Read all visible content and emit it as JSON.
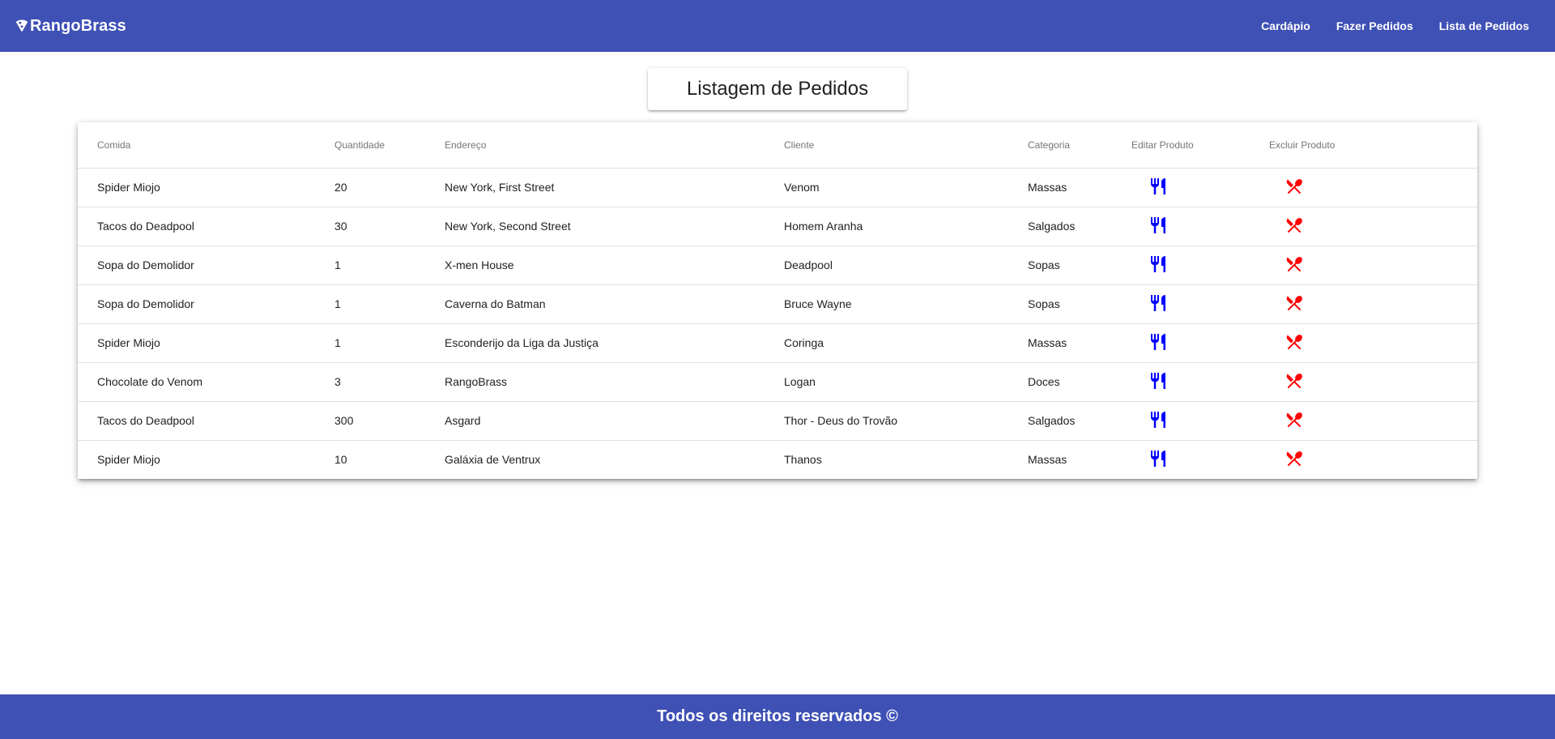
{
  "brand": {
    "name": "RangoBrass",
    "icon": "pizza-icon"
  },
  "nav": {
    "links": [
      {
        "label": "Cardápio"
      },
      {
        "label": "Fazer Pedidos"
      },
      {
        "label": "Lista de Pedidos"
      }
    ]
  },
  "page": {
    "title": "Listagem de Pedidos"
  },
  "table": {
    "headers": [
      "Comida",
      "Quantidade",
      "Endereço",
      "Cliente",
      "Categoria",
      "Editar Produto",
      "Excluir Produto"
    ],
    "rows": [
      {
        "comida": "Spider Miojo",
        "quantidade": "20",
        "endereco": "New York, First Street",
        "cliente": "Venom",
        "categoria": "Massas"
      },
      {
        "comida": "Tacos do Deadpool",
        "quantidade": "30",
        "endereco": "New York, Second Street",
        "cliente": "Homem Aranha",
        "categoria": "Salgados"
      },
      {
        "comida": "Sopa do Demolidor",
        "quantidade": "1",
        "endereco": "X-men House",
        "cliente": "Deadpool",
        "categoria": "Sopas"
      },
      {
        "comida": "Sopa do Demolidor",
        "quantidade": "1",
        "endereco": "Caverna do Batman",
        "cliente": "Bruce Wayne",
        "categoria": "Sopas"
      },
      {
        "comida": "Spider Miojo",
        "quantidade": "1",
        "endereco": "Esconderijo da Liga da Justiça",
        "cliente": "Coringa",
        "categoria": "Massas"
      },
      {
        "comida": "Chocolate do Venom",
        "quantidade": "3",
        "endereco": "RangoBrass",
        "cliente": "Logan",
        "categoria": "Doces"
      },
      {
        "comida": "Tacos do Deadpool",
        "quantidade": "300",
        "endereco": "Asgard",
        "cliente": "Thor - Deus do Trovão",
        "categoria": "Salgados"
      },
      {
        "comida": "Spider Miojo",
        "quantidade": "10",
        "endereco": "Galáxia de Ventrux",
        "cliente": "Thanos",
        "categoria": "Massas"
      }
    ],
    "edit_icon": "fork-knife-icon",
    "delete_icon": "crossed-fork-knife-icon"
  },
  "footer": {
    "text": "Todos os direitos reservados ©"
  },
  "colors": {
    "primary": "#3f51b5",
    "edit": "#0000ff",
    "delete": "#ff0000"
  }
}
